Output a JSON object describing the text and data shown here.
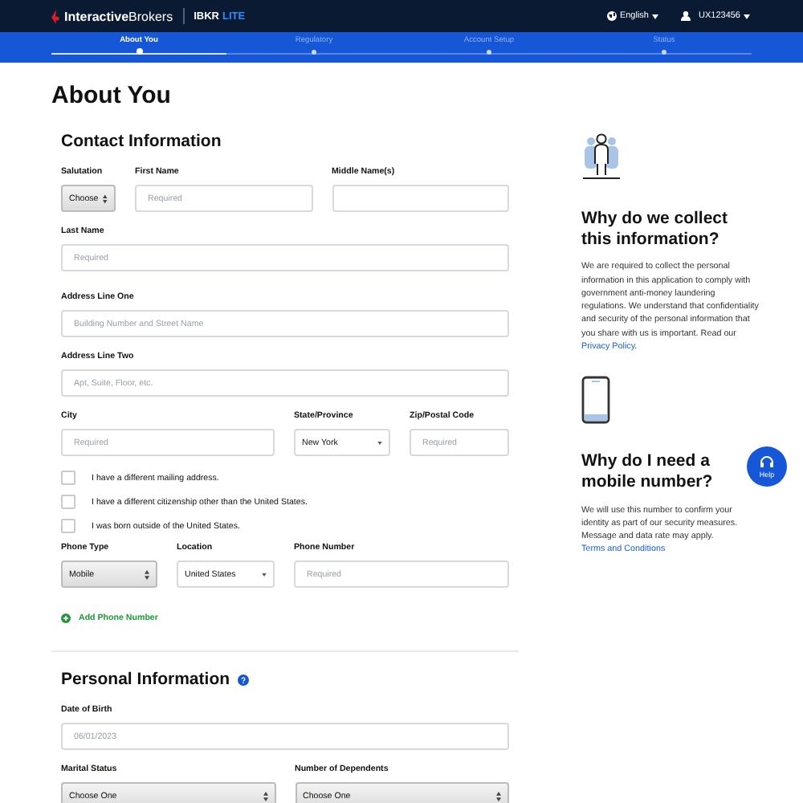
{
  "header": {
    "brand": "**Interactive**Brokers",
    "product": "IBKR",
    "product_tag": "LITE",
    "language": "English",
    "user": "UX123456"
  },
  "steps": [
    {
      "label": "About You",
      "selected": true
    },
    {
      "label": "Regulatory",
      "selected": false
    },
    {
      "label": "Account Setup",
      "selected": false
    },
    {
      "label": "Status",
      "selected": false
    }
  ],
  "progress": {
    "level": 0.25
  },
  "page_title": "About You",
  "contact": {
    "title": "Contact Information",
    "rows": [
      [
        {
          "label": "Salutation",
          "kind": "native-select",
          "value": "Choose"
        },
        {
          "label": "First Name",
          "kind": "text",
          "placeholder": "Required"
        },
        {
          "label": "Middle Name(s)",
          "kind": "text"
        }
      ],
      [
        {
          "label": "Last Name",
          "kind": "text",
          "placeholder": "Required"
        }
      ],
      [
        {
          "label": "Address Line One",
          "kind": "text",
          "placeholder": "Building Number and Street Name"
        }
      ],
      [
        {
          "label": "Address Line Two",
          "kind": "text",
          "placeholder": "Apt, Suite, Floor, etc."
        }
      ],
      [
        {
          "label": "City",
          "kind": "text",
          "placeholder": "Required"
        },
        {
          "label": "State/Province",
          "kind": "dropdown",
          "value": "New York"
        },
        {
          "label": "Zip/Postal Code",
          "kind": "text",
          "placeholder": "Required"
        }
      ]
    ],
    "checkboxes": [
      {
        "label": "I have a different mailing address.",
        "checked": false
      },
      {
        "label": "I have a different citizenship other than the United States.",
        "checked": false
      },
      {
        "label": "I was born outside of the United States.",
        "checked": false
      }
    ],
    "phone_row": [
      {
        "label": "Phone Type",
        "kind": "native-select",
        "value": "Mobile"
      },
      {
        "label": "Location",
        "kind": "dropdown",
        "value": "United States"
      },
      {
        "label": "Phone Number",
        "kind": "text",
        "placeholder": "Required"
      }
    ],
    "add_phone": "Add Phone Number"
  },
  "personal": {
    "title": "Personal Information",
    "rows": [
      [
        {
          "label": "Date of Birth",
          "kind": "text",
          "placeholder": "06/01/2023"
        }
      ],
      [
        {
          "label": "Marital Status",
          "kind": "native-select",
          "value": "Choose One"
        },
        {
          "label": "Number of Dependents",
          "kind": "native-select",
          "value": "Choose One"
        }
      ]
    ]
  },
  "sidebar": [
    {
      "kind": "person",
      "title": "Why do we collect this information?",
      "text": "We are required to collect the personal information in this application to comply with government anti-money laundering regulations. We understand that confidentiality and security of the personal information that you share with us is important. Read our",
      "link": "Privacy Policy",
      "after": "."
    },
    {
      "kind": "phone",
      "title": "Why do I need a mobile number?",
      "text": "We will use this number to confirm your identity as part of our security measures. Message and data rate may apply.",
      "link": "Terms and Conditions"
    }
  ],
  "help": "Help"
}
